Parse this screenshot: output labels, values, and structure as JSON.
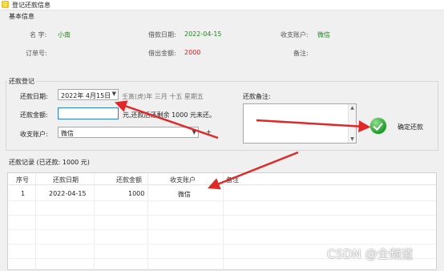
{
  "window": {
    "title": "登记还款信息"
  },
  "basic_info": {
    "group_title": "基本信息",
    "name_label": "名 字:",
    "name_value": "小南",
    "borrow_date_label": "借款日期:",
    "borrow_date_value": "2022-04-15",
    "pay_account_label": "收支账户:",
    "pay_account_value": "微信",
    "order_label": "订单号:",
    "order_value": "",
    "amount_label": "借出金额:",
    "amount_value": "2000",
    "remark_label": "备注:",
    "remark_value": ""
  },
  "repay_form": {
    "group_title": "还款登记",
    "date_label": "还款日期:",
    "date_value": "2022年 4月15日",
    "lunar_text": "壬寅(虎)年 三月 十五 星期五",
    "amount_label": "还款金额:",
    "amount_value": "",
    "amount_hint": "元,还款后还剩余 1000 元未还。",
    "account_label": "收支账户:",
    "account_value": "微信",
    "account_extra": "+",
    "remark_label": "还款备注:",
    "remark_value": "",
    "confirm_button": "确定还款"
  },
  "records": {
    "group_title": "还款记录 (已还款: 1000 元)",
    "columns": [
      "序号",
      "还款日期",
      "还款金额",
      "收支账户",
      "备注"
    ],
    "rows": [
      {
        "index": "1",
        "date": "2022-04-15",
        "amount": "1000",
        "account": "微信",
        "remark": ""
      }
    ]
  },
  "watermark": "CSDN @全频道",
  "colors": {
    "annotation_arrow": "#e02828",
    "confirm_green": "#1f9a2a",
    "value_green": "#1b8a1b",
    "value_red": "#d21a1a"
  }
}
